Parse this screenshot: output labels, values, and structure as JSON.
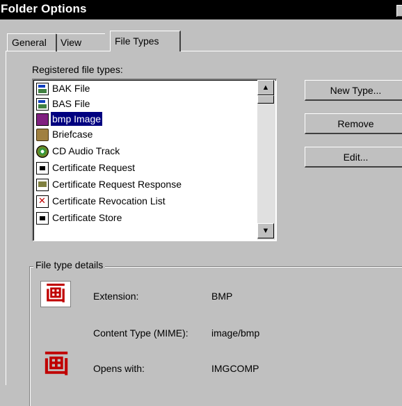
{
  "window": {
    "title": "Folder Options"
  },
  "tabs": [
    "General",
    "View",
    "File Types"
  ],
  "registered": {
    "label": "Registered file types:",
    "items": [
      {
        "label": "BAK File",
        "icon": "document-icon",
        "selected": false
      },
      {
        "label": "BAS File",
        "icon": "document-icon",
        "selected": false
      },
      {
        "label": "bmp Image",
        "icon": "bitmap-icon",
        "selected": true
      },
      {
        "label": "Briefcase",
        "icon": "briefcase-icon",
        "selected": false
      },
      {
        "label": "CD Audio Track",
        "icon": "cd-audio-icon",
        "selected": false
      },
      {
        "label": "Certificate Request",
        "icon": "certificate-icon",
        "selected": false
      },
      {
        "label": "Certificate Request Response",
        "icon": "certificate-response-icon",
        "selected": false
      },
      {
        "label": "Certificate Revocation List",
        "icon": "certificate-revocation-icon",
        "selected": false
      },
      {
        "label": "Certificate Store",
        "icon": "certificate-icon",
        "selected": false
      }
    ]
  },
  "buttons": {
    "new_type": "New Type...",
    "remove": "Remove",
    "edit": "Edit..."
  },
  "details": {
    "title": "File type details",
    "icon_glyph": "画",
    "extension_label": "Extension:",
    "extension_value": "BMP",
    "mime_label": "Content Type (MIME):",
    "mime_value": "image/bmp",
    "opens_label": "Opens with:",
    "opens_value": "IMGCOMP"
  }
}
